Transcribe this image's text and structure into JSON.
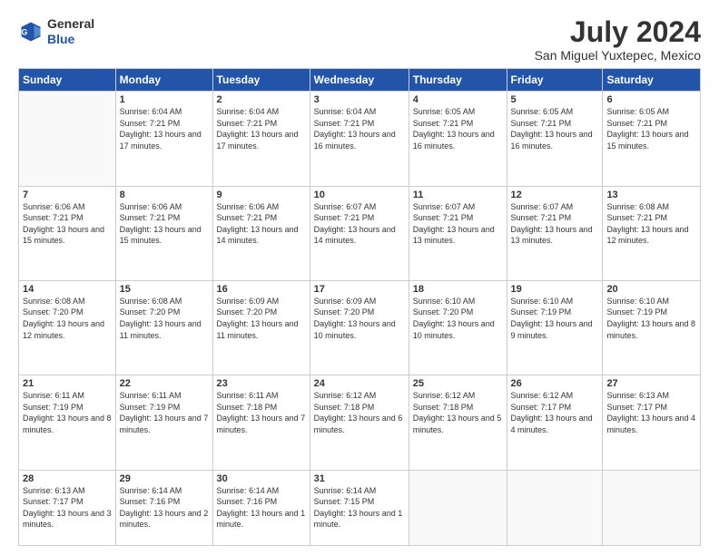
{
  "logo": {
    "general": "General",
    "blue": "Blue"
  },
  "header": {
    "month_year": "July 2024",
    "location": "San Miguel Yuxtepec, Mexico"
  },
  "days_of_week": [
    "Sunday",
    "Monday",
    "Tuesday",
    "Wednesday",
    "Thursday",
    "Friday",
    "Saturday"
  ],
  "weeks": [
    [
      {
        "day": "",
        "sunrise": "",
        "sunset": "",
        "daylight": "",
        "empty": true
      },
      {
        "day": "1",
        "sunrise": "Sunrise: 6:04 AM",
        "sunset": "Sunset: 7:21 PM",
        "daylight": "Daylight: 13 hours and 17 minutes."
      },
      {
        "day": "2",
        "sunrise": "Sunrise: 6:04 AM",
        "sunset": "Sunset: 7:21 PM",
        "daylight": "Daylight: 13 hours and 17 minutes."
      },
      {
        "day": "3",
        "sunrise": "Sunrise: 6:04 AM",
        "sunset": "Sunset: 7:21 PM",
        "daylight": "Daylight: 13 hours and 16 minutes."
      },
      {
        "day": "4",
        "sunrise": "Sunrise: 6:05 AM",
        "sunset": "Sunset: 7:21 PM",
        "daylight": "Daylight: 13 hours and 16 minutes."
      },
      {
        "day": "5",
        "sunrise": "Sunrise: 6:05 AM",
        "sunset": "Sunset: 7:21 PM",
        "daylight": "Daylight: 13 hours and 16 minutes."
      },
      {
        "day": "6",
        "sunrise": "Sunrise: 6:05 AM",
        "sunset": "Sunset: 7:21 PM",
        "daylight": "Daylight: 13 hours and 15 minutes."
      }
    ],
    [
      {
        "day": "7",
        "sunrise": "Sunrise: 6:06 AM",
        "sunset": "Sunset: 7:21 PM",
        "daylight": "Daylight: 13 hours and 15 minutes."
      },
      {
        "day": "8",
        "sunrise": "Sunrise: 6:06 AM",
        "sunset": "Sunset: 7:21 PM",
        "daylight": "Daylight: 13 hours and 15 minutes."
      },
      {
        "day": "9",
        "sunrise": "Sunrise: 6:06 AM",
        "sunset": "Sunset: 7:21 PM",
        "daylight": "Daylight: 13 hours and 14 minutes."
      },
      {
        "day": "10",
        "sunrise": "Sunrise: 6:07 AM",
        "sunset": "Sunset: 7:21 PM",
        "daylight": "Daylight: 13 hours and 14 minutes."
      },
      {
        "day": "11",
        "sunrise": "Sunrise: 6:07 AM",
        "sunset": "Sunset: 7:21 PM",
        "daylight": "Daylight: 13 hours and 13 minutes."
      },
      {
        "day": "12",
        "sunrise": "Sunrise: 6:07 AM",
        "sunset": "Sunset: 7:21 PM",
        "daylight": "Daylight: 13 hours and 13 minutes."
      },
      {
        "day": "13",
        "sunrise": "Sunrise: 6:08 AM",
        "sunset": "Sunset: 7:21 PM",
        "daylight": "Daylight: 13 hours and 12 minutes."
      }
    ],
    [
      {
        "day": "14",
        "sunrise": "Sunrise: 6:08 AM",
        "sunset": "Sunset: 7:20 PM",
        "daylight": "Daylight: 13 hours and 12 minutes."
      },
      {
        "day": "15",
        "sunrise": "Sunrise: 6:08 AM",
        "sunset": "Sunset: 7:20 PM",
        "daylight": "Daylight: 13 hours and 11 minutes."
      },
      {
        "day": "16",
        "sunrise": "Sunrise: 6:09 AM",
        "sunset": "Sunset: 7:20 PM",
        "daylight": "Daylight: 13 hours and 11 minutes."
      },
      {
        "day": "17",
        "sunrise": "Sunrise: 6:09 AM",
        "sunset": "Sunset: 7:20 PM",
        "daylight": "Daylight: 13 hours and 10 minutes."
      },
      {
        "day": "18",
        "sunrise": "Sunrise: 6:10 AM",
        "sunset": "Sunset: 7:20 PM",
        "daylight": "Daylight: 13 hours and 10 minutes."
      },
      {
        "day": "19",
        "sunrise": "Sunrise: 6:10 AM",
        "sunset": "Sunset: 7:19 PM",
        "daylight": "Daylight: 13 hours and 9 minutes."
      },
      {
        "day": "20",
        "sunrise": "Sunrise: 6:10 AM",
        "sunset": "Sunset: 7:19 PM",
        "daylight": "Daylight: 13 hours and 8 minutes."
      }
    ],
    [
      {
        "day": "21",
        "sunrise": "Sunrise: 6:11 AM",
        "sunset": "Sunset: 7:19 PM",
        "daylight": "Daylight: 13 hours and 8 minutes."
      },
      {
        "day": "22",
        "sunrise": "Sunrise: 6:11 AM",
        "sunset": "Sunset: 7:19 PM",
        "daylight": "Daylight: 13 hours and 7 minutes."
      },
      {
        "day": "23",
        "sunrise": "Sunrise: 6:11 AM",
        "sunset": "Sunset: 7:18 PM",
        "daylight": "Daylight: 13 hours and 7 minutes."
      },
      {
        "day": "24",
        "sunrise": "Sunrise: 6:12 AM",
        "sunset": "Sunset: 7:18 PM",
        "daylight": "Daylight: 13 hours and 6 minutes."
      },
      {
        "day": "25",
        "sunrise": "Sunrise: 6:12 AM",
        "sunset": "Sunset: 7:18 PM",
        "daylight": "Daylight: 13 hours and 5 minutes."
      },
      {
        "day": "26",
        "sunrise": "Sunrise: 6:12 AM",
        "sunset": "Sunset: 7:17 PM",
        "daylight": "Daylight: 13 hours and 4 minutes."
      },
      {
        "day": "27",
        "sunrise": "Sunrise: 6:13 AM",
        "sunset": "Sunset: 7:17 PM",
        "daylight": "Daylight: 13 hours and 4 minutes."
      }
    ],
    [
      {
        "day": "28",
        "sunrise": "Sunrise: 6:13 AM",
        "sunset": "Sunset: 7:17 PM",
        "daylight": "Daylight: 13 hours and 3 minutes."
      },
      {
        "day": "29",
        "sunrise": "Sunrise: 6:14 AM",
        "sunset": "Sunset: 7:16 PM",
        "daylight": "Daylight: 13 hours and 2 minutes."
      },
      {
        "day": "30",
        "sunrise": "Sunrise: 6:14 AM",
        "sunset": "Sunset: 7:16 PM",
        "daylight": "Daylight: 13 hours and 1 minute."
      },
      {
        "day": "31",
        "sunrise": "Sunrise: 6:14 AM",
        "sunset": "Sunset: 7:15 PM",
        "daylight": "Daylight: 13 hours and 1 minute."
      },
      {
        "day": "",
        "sunrise": "",
        "sunset": "",
        "daylight": "",
        "empty": true
      },
      {
        "day": "",
        "sunrise": "",
        "sunset": "",
        "daylight": "",
        "empty": true
      },
      {
        "day": "",
        "sunrise": "",
        "sunset": "",
        "daylight": "",
        "empty": true
      }
    ]
  ]
}
